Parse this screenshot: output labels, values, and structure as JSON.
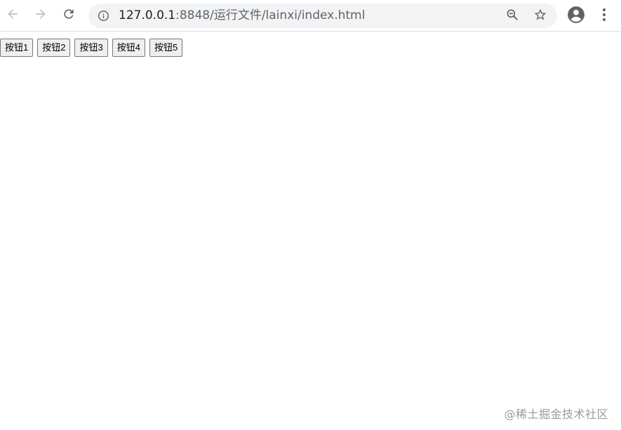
{
  "browser": {
    "url_host": "127.0.0.1",
    "url_path": ":8848/运行文件/lainxi/index.html"
  },
  "page": {
    "buttons": [
      {
        "label": "按钮1"
      },
      {
        "label": "按钮2"
      },
      {
        "label": "按钮3"
      },
      {
        "label": "按钮4"
      },
      {
        "label": "按钮5"
      }
    ]
  },
  "watermark": {
    "text": "@稀土掘金技术社区"
  },
  "icons": {
    "back": "back-arrow-icon",
    "forward": "forward-arrow-icon",
    "reload": "reload-icon",
    "site_info": "info-icon",
    "zoom": "zoom-out-icon",
    "bookmark": "star-icon",
    "profile": "account-circle-icon",
    "menu": "kebab-menu-icon"
  },
  "colors": {
    "toolbar_bg": "#ffffff",
    "omnibox_bg": "#f1f3f4",
    "icon_active": "#5f6368",
    "icon_disabled": "#bdc1c6"
  }
}
